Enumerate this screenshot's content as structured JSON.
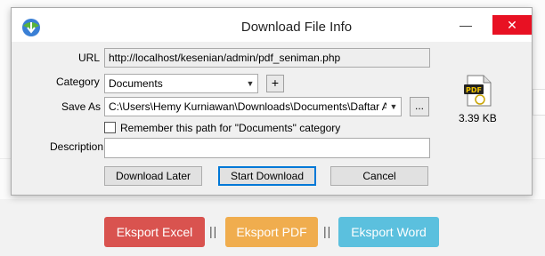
{
  "dialog": {
    "title": "Download File Info",
    "url_label": "URL",
    "url_value": "http://localhost/kesenian/admin/pdf_seniman.php",
    "category_label": "Category",
    "category_value": "Documents",
    "add_category_label": "+",
    "saveas_label": "Save As",
    "saveas_value": "C:\\Users\\Hemy Kurniawan\\Downloads\\Documents\\Daftar Arsip S",
    "browse_label": "...",
    "remember_label": "Remember this path for \"Documents\" category",
    "remember_checked": false,
    "description_label": "Description",
    "description_value": "",
    "file_size": "3.39  KB",
    "file_icon": "pdf-file-icon",
    "buttons": {
      "download_later": "Download Later",
      "start_download": "Start Download",
      "cancel": "Cancel"
    }
  },
  "page": {
    "export_excel": "Eksport Excel",
    "export_pdf": "Eksport PDF",
    "export_word": "Eksport Word",
    "separator": "||",
    "colors": {
      "excel": "#d9534f",
      "pdf": "#f0ad4e",
      "word": "#5bc0de"
    }
  }
}
